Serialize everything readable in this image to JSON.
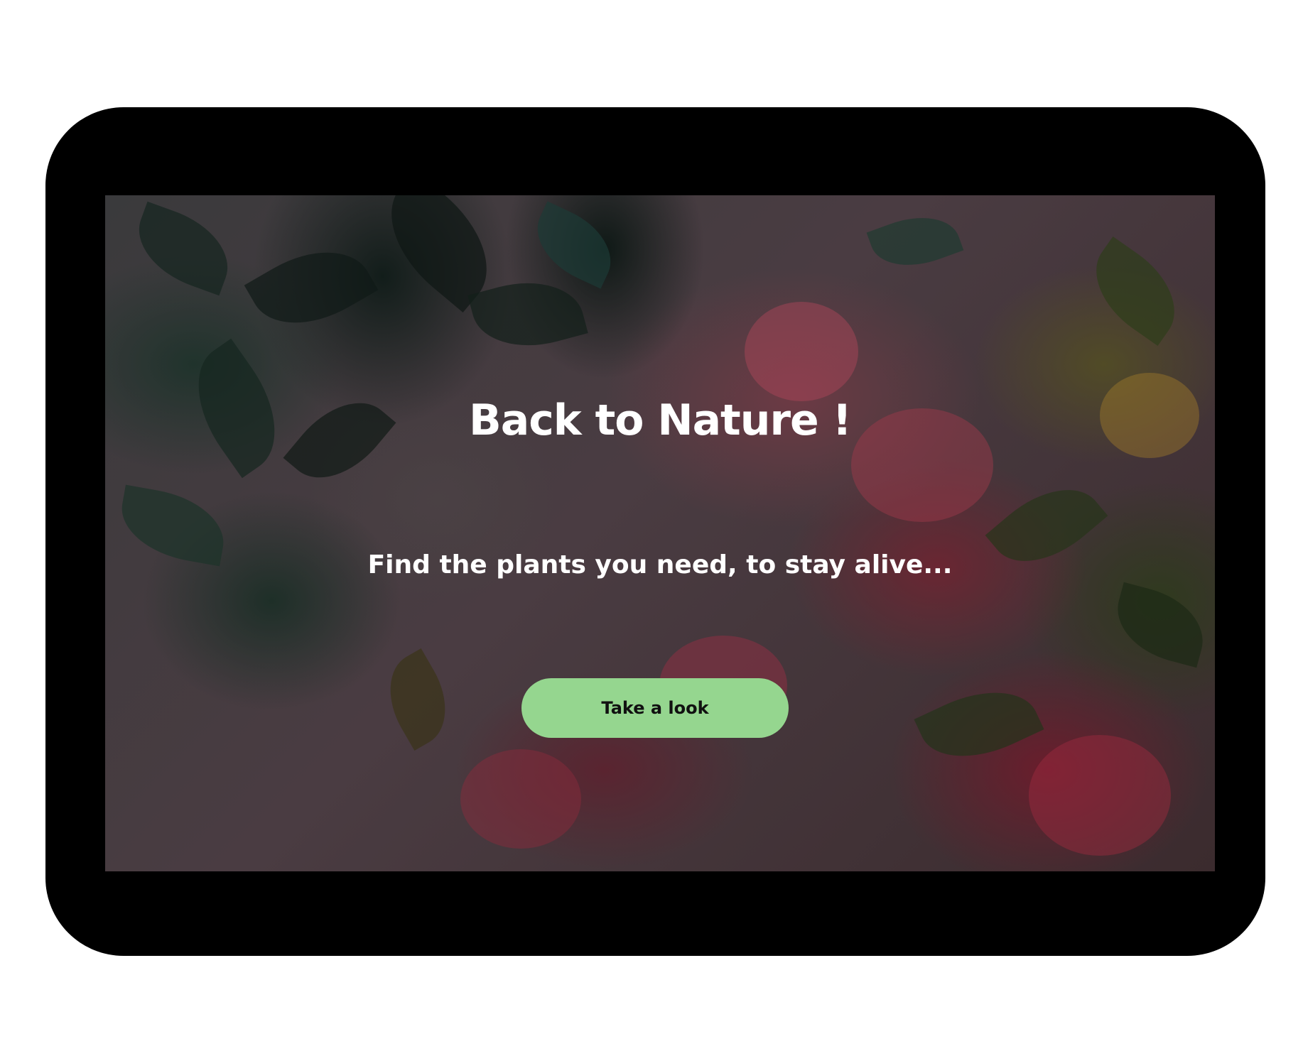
{
  "hero": {
    "title": "Back to Nature !",
    "subtitle": "Find the plants you need, to stay alive...",
    "cta_label": "Take a look"
  },
  "colors": {
    "frame": "#000000",
    "cta_background": "#95d68f",
    "text": "#ffffff"
  }
}
